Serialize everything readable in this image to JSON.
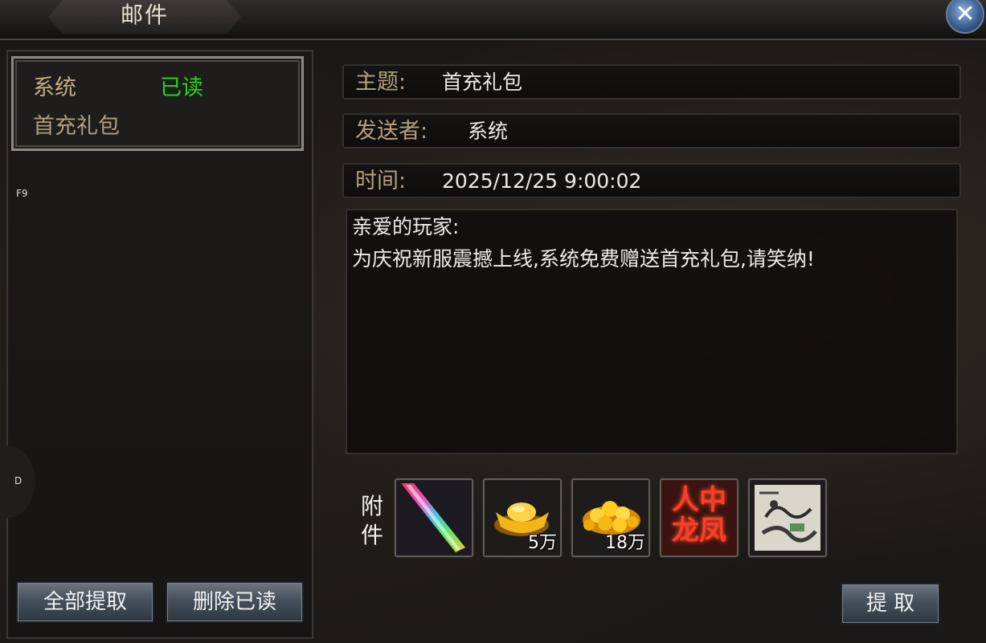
{
  "window": {
    "title": "邮件",
    "close_symbol": "✕"
  },
  "hotkeys": {
    "f9": "F9",
    "d": "D"
  },
  "mail_list": [
    {
      "sender": "系统",
      "status": "已读",
      "subject": "首充礼包"
    }
  ],
  "left_buttons": {
    "claim_all": "全部提取",
    "delete_read": "删除已读"
  },
  "detail": {
    "subject_label": "主题:",
    "subject_value": "首充礼包",
    "sender_label": "发送者:",
    "sender_value": "系统",
    "time_label": "时间:",
    "time_value": "2025/12/25 9:00:02",
    "greeting": "亲爱的玩家:",
    "body": "为庆祝新服震撼上线,系统免费赠送首充礼包,请笑纳!"
  },
  "attachments": {
    "label": "附件",
    "items": [
      {
        "icon": "rainbow-sword-icon",
        "quantity": ""
      },
      {
        "icon": "gold-ingot-icon",
        "quantity": "5万"
      },
      {
        "icon": "gold-coins-pile-icon",
        "quantity": "18万"
      },
      {
        "icon": "title-renzhong-longfeng-icon",
        "text": "人中龙凤",
        "quantity": ""
      },
      {
        "icon": "skill-book-painting-icon",
        "quantity": ""
      }
    ]
  },
  "claim_button": "提 取",
  "colors": {
    "status_read": "#27d21d",
    "label_gold": "#b4a07f",
    "button_steel": "#46505c"
  }
}
